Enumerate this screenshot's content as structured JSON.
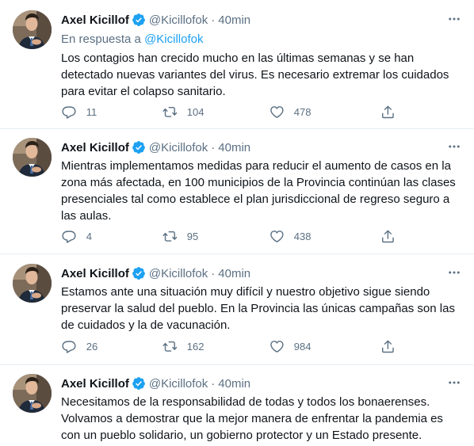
{
  "author": {
    "name": "Axel Kicillof",
    "handle": "@Kicillofok",
    "separator": "·",
    "avatar_icon": "profile-photo",
    "verified_icon": "verified-badge-icon"
  },
  "colors": {
    "accent": "#1da1f2",
    "secondary_text": "#5b7083",
    "divider": "#e6ecf0"
  },
  "tweets": [
    {
      "time": "40min",
      "reply_label": "En respuesta a",
      "reply_handle": "@Kicillofok",
      "text": "Los contagios han crecido mucho en las últimas semanas y se han detectado nuevas variantes del virus. Es necesario extremar los cuidados para evitar el colapso sanitario.",
      "replies": "11",
      "retweets": "104",
      "likes": "478"
    },
    {
      "time": "40min",
      "text": "Mientras implementamos medidas para reducir el aumento de casos en la zona más afectada, en 100 municipios de la Provincia continúan las clases presenciales tal como establece el plan jurisdiccional de regreso seguro a las aulas.",
      "replies": "4",
      "retweets": "95",
      "likes": "438"
    },
    {
      "time": "40min",
      "text": "Estamos ante una situación muy difícil y nuestro objetivo sigue siendo preservar la salud del pueblo. En la Provincia las únicas campañas son las de cuidados y la de vacunación.",
      "replies": "26",
      "retweets": "162",
      "likes": "984"
    },
    {
      "time": "40min",
      "text": "Necesitamos de la responsabilidad de todas y todos los bonaerenses. Volvamos a demostrar que la mejor manera de enfrentar la pandemia es con un pueblo solidario, un gobierno protector y un Estado presente."
    }
  ]
}
